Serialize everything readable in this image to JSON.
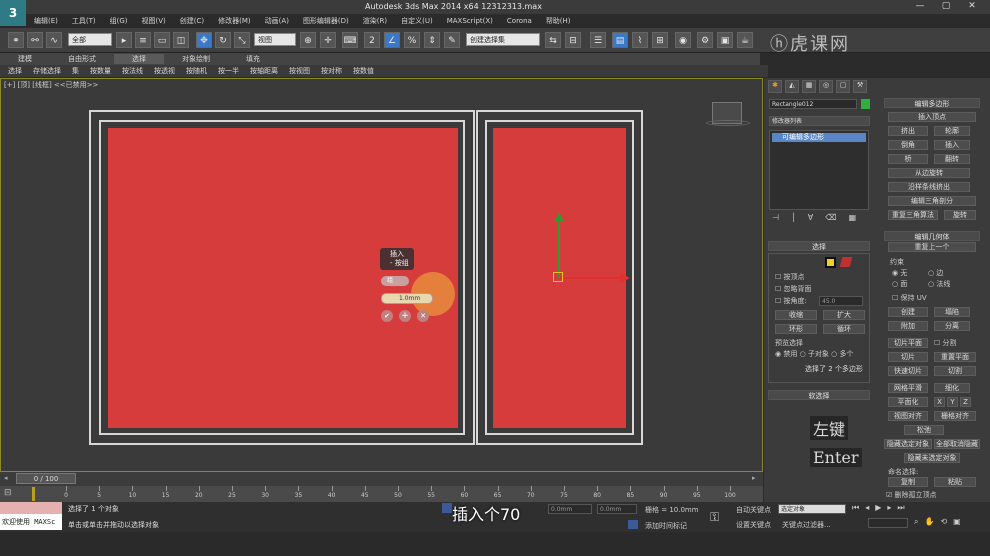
{
  "app": {
    "title": "Autodesk 3ds Max  2014 x64     12312313.max",
    "logo": "3"
  },
  "menu": [
    "编辑(E)",
    "工具(T)",
    "组(G)",
    "视图(V)",
    "创建(C)",
    "修改器(M)",
    "动画(A)",
    "图形编辑器(D)",
    "渲染(R)",
    "自定义(U)",
    "MAXScript(X)",
    "Corona",
    "帮助(H)"
  ],
  "window_controls": [
    "—",
    "▢",
    "✕"
  ],
  "toolbar": {
    "selection_filter": "全部",
    "ref_coord": "视图",
    "named_selection": "创建选择集"
  },
  "ribbon": {
    "tabs": [
      "建模",
      "自由形式",
      "选择",
      "对象绘制",
      "填充"
    ],
    "active": "选择"
  },
  "cmdbar": [
    "选择",
    "存储选择",
    "集",
    "按数量",
    "按法线",
    "按透视",
    "按随机",
    "按一半",
    "按轴距离",
    "按视图",
    "按对称",
    "按数值"
  ],
  "viewport": {
    "label": "[+] [顶] [线框]  <<已禁用>>",
    "accent": "#d63c3c"
  },
  "inset_caddy": {
    "title_line1": "插入",
    "title_line2": "- 按组",
    "type_label": "组",
    "amount": "1.0mm",
    "ok": "✔",
    "apply": "+",
    "cancel": "✕"
  },
  "panel": {
    "object_name": "Rectangle012",
    "modifier_list": "修改器列表",
    "stack_item": "可编辑多边形",
    "edit_polygons": {
      "header": "编辑多边形",
      "insert_vertex": "插入顶点",
      "buttons": [
        "挤出",
        "轮廓",
        "倒角",
        "插入",
        "桥",
        "翻转"
      ],
      "hinge": "从边旋转",
      "extrude_spline": "沿样条线挤出",
      "edit_tri": "编辑三角剖分",
      "retri": "重复三角算法",
      "turn": "旋转"
    },
    "edit_geometry": {
      "header": "编辑几何体",
      "repeat": "重复上一个",
      "constraints": "约束",
      "c_none": "无",
      "c_edge": "边",
      "c_face": "面",
      "c_normal": "法线",
      "preserve_uv": "保持 UV",
      "create": "创建",
      "collapse": "塌陷",
      "attach": "附加",
      "detach": "分离",
      "slice_plane": "切片平面",
      "split": "分割",
      "slice": "切片",
      "reset_plane": "重置平面",
      "quickslice": "快速切片",
      "cut": "切割",
      "msmooth": "网格平滑",
      "tessellate": "细化",
      "planar": "平面化",
      "x": "X",
      "y": "Y",
      "z": "Z",
      "view_align": "视图对齐",
      "grid_align": "栅格对齐",
      "relax": "松弛",
      "hide_sel": "隐藏选定对象",
      "unhide_all": "全部取消隐藏",
      "hide_unsel": "隐藏未选定对象",
      "named_sel": "命名选择:",
      "copy": "复制",
      "paste": "粘贴",
      "delete_iso": "删除孤立顶点"
    },
    "selection": {
      "header": "选择",
      "by_vertex": "按顶点",
      "ignore_back": "忽略背面",
      "by_angle": "按角度:",
      "angle_value": "45.0",
      "shrink": "收缩",
      "grow": "扩大",
      "ring": "环形",
      "loop": "循环",
      "preview": "预览选择",
      "p_off": "禁用",
      "p_sub": "子对象",
      "p_multi": "多个",
      "status": "选择了 2 个多边形",
      "soft": "软选择"
    }
  },
  "keys": [
    "左键",
    "Enter"
  ],
  "timeline": {
    "frame": "0 / 100",
    "ticks": [
      "0",
      "5",
      "10",
      "15",
      "20",
      "25",
      "30",
      "35",
      "40",
      "45",
      "50",
      "55",
      "60",
      "65",
      "70",
      "75",
      "80",
      "85",
      "90",
      "95",
      "100"
    ]
  },
  "status": {
    "welcome": "欢迎使用 MAXSc",
    "selected": "选择了 1 个对象",
    "prompt": "单击或单击并拖动以选择对象",
    "x": "0.0mm",
    "y": "0.0mm",
    "z": "0.0mm",
    "grid": "栅格 = 10.0mm",
    "autokey": "自动关键点",
    "autokey_sel": "选定对象",
    "setkey": "设置关键点",
    "keyfilter": "关键点过滤器...",
    "addtime": "添加时间标记"
  },
  "caption": "插入个70"
}
